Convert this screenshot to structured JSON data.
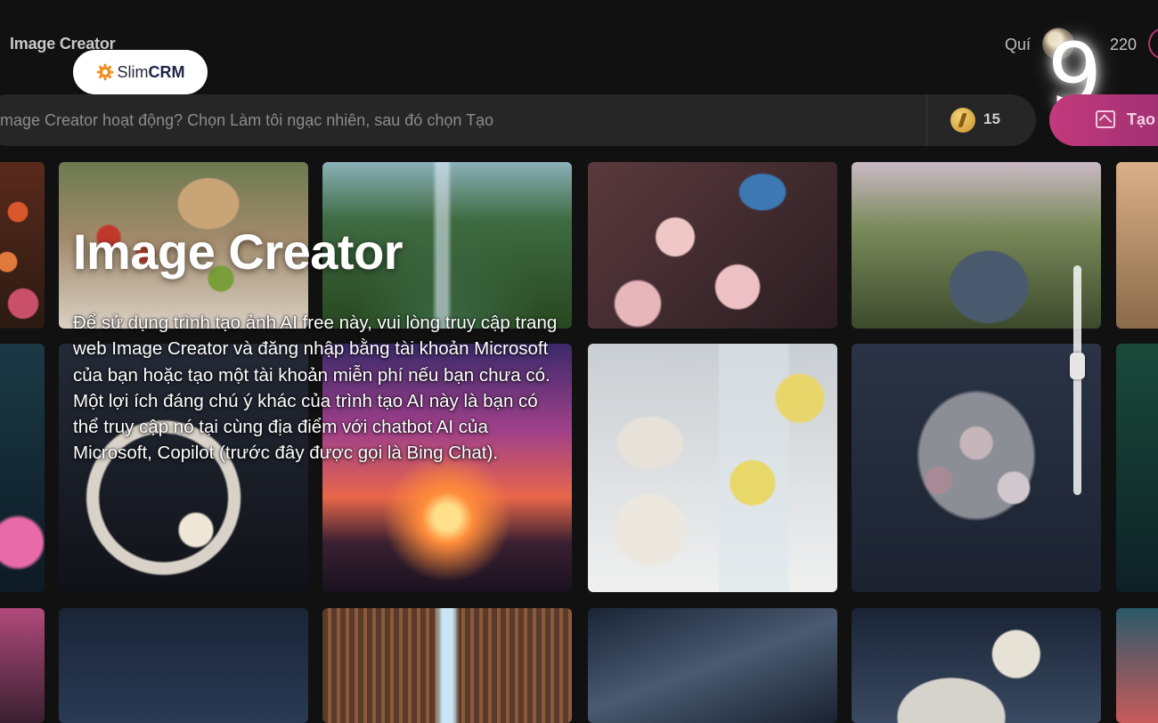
{
  "header": {
    "app_title": "Image Creator",
    "user_name": "Quí",
    "credits": "220"
  },
  "brand_badge": {
    "prefix": "Slim",
    "suffix": "CRM"
  },
  "step_number": "9",
  "prompt": {
    "placeholder": "mage Creator hoạt động? Chọn Làm tôi ngạc nhiên, sau đó chọn Tạo",
    "boost_count": "15",
    "create_label": "Tạo"
  },
  "overlay": {
    "title": "Image Creator",
    "description": "Để sử dụng trình tạo ảnh AI free này, vui lòng truy cập trang web Image Creator và đăng nhập bằng tài khoản Microsoft của bạn hoặc tạo một tài khoản miễn phí nếu bạn chưa có. Một lợi ích đáng chú ý khác của trình tạo AI này là bạn có thể truy cập nó tại cùng địa điểm với chatbot AI của Microsoft, Copilot (trước đây được gọi là Bing Chat)."
  },
  "colors": {
    "background": "#111112",
    "accent": "#c23a7c",
    "prompt_bar": "#262627"
  },
  "icons": {
    "brand": "gear-icon",
    "boost": "boost-coin-icon",
    "create": "image-add-icon"
  }
}
